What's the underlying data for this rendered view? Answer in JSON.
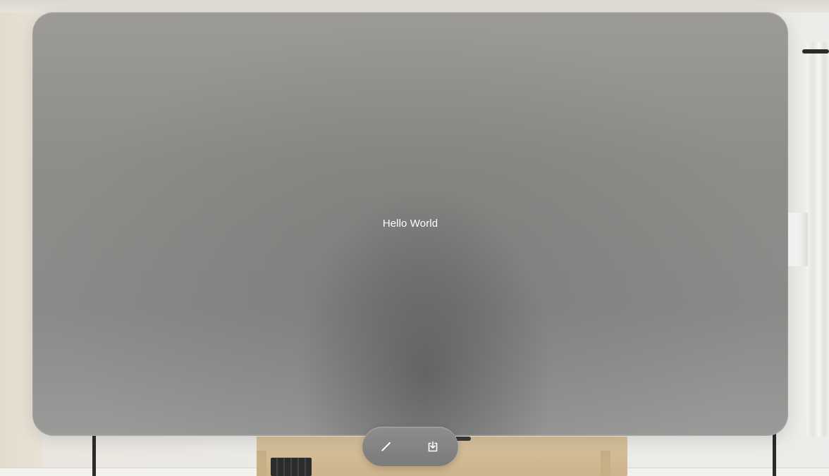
{
  "window": {
    "content_text": "Hello World"
  },
  "toolbar": {
    "buttons": [
      {
        "icon": "pencil-icon"
      },
      {
        "icon": "download-icon"
      }
    ]
  },
  "colors": {
    "window_glass": "#8e8d89",
    "text": "#ffffff",
    "toolbar": "#858583"
  }
}
